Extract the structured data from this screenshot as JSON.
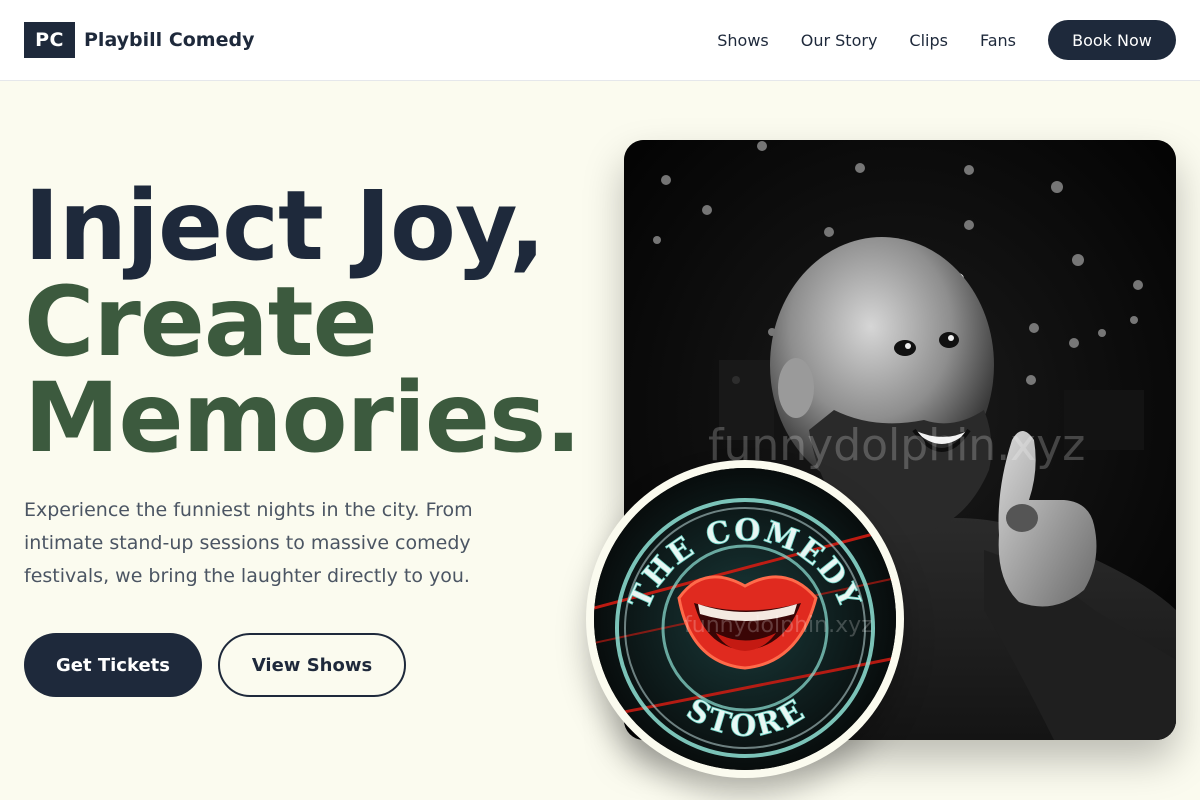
{
  "brand": {
    "mark": "PC",
    "name": "Playbill Comedy"
  },
  "nav": {
    "items": [
      {
        "label": "Shows"
      },
      {
        "label": "Our Story"
      },
      {
        "label": "Clips"
      },
      {
        "label": "Fans"
      }
    ],
    "cta": "Book Now"
  },
  "hero": {
    "headline": {
      "line1": "Inject Joy,",
      "line2": "Create",
      "line3": "Memories."
    },
    "subtext": "Experience the funniest nights in the city. From intimate stand-up sessions to massive comedy festivals, we bring the laughter directly to you.",
    "primary_button": "Get Tickets",
    "secondary_button": "View Shows"
  },
  "images": {
    "comedian_watermark": "funnydolphin.xyz",
    "sign_watermark": "funnydolphin.xyz",
    "sign_text_top": "THE COMEDY",
    "sign_text_bottom": "STORE"
  },
  "colors": {
    "navy": "#1e293b",
    "forest_green": "#3c5a3e",
    "cream_background": "#fbfbef",
    "neon_red": "#e02a1f",
    "neon_teal": "#8fe3d6"
  }
}
